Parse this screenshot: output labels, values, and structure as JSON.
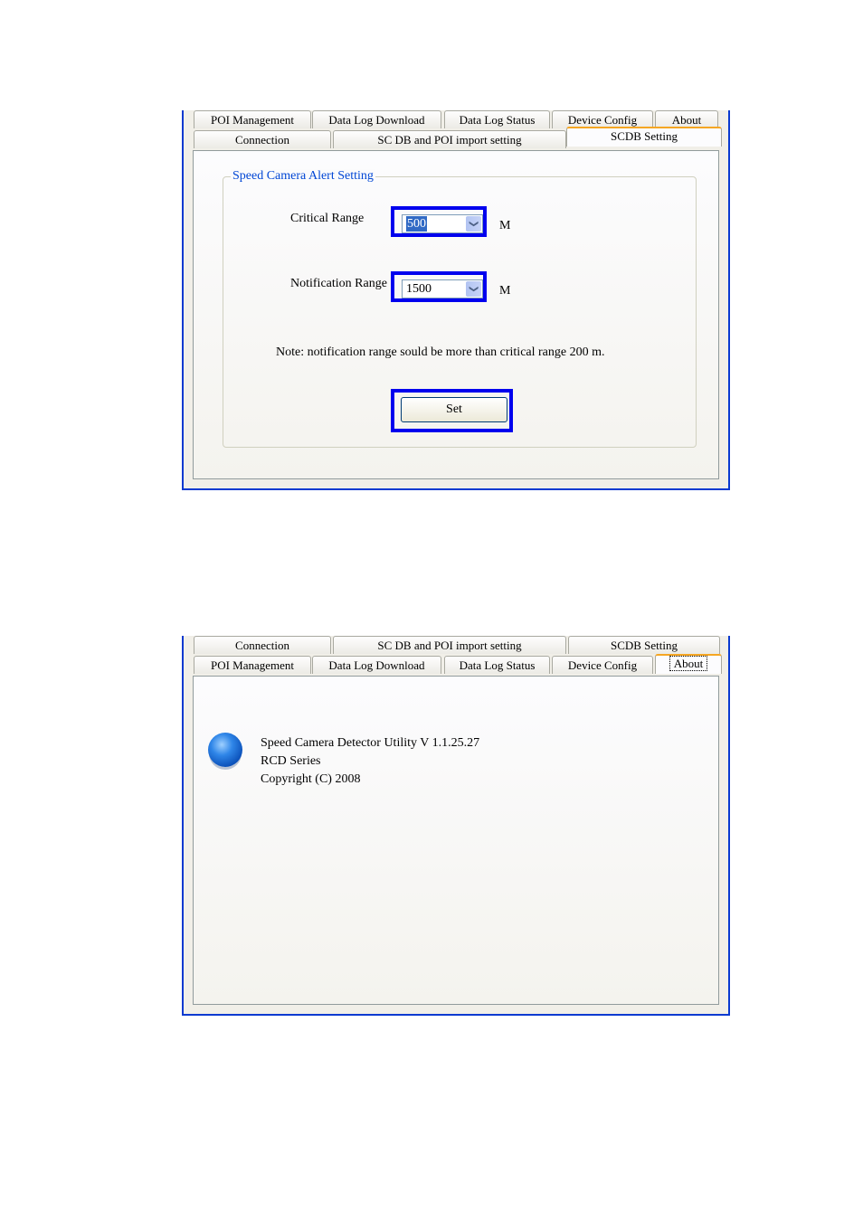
{
  "screens": [
    {
      "tabs_back_row": [
        "POI Management",
        "Data Log Download",
        "Data Log Status",
        "Device Config",
        "About"
      ],
      "tabs_front_row": [
        "Connection",
        "SC DB and POI import setting",
        "SCDB  Setting"
      ],
      "active_tab": "SCDB  Setting",
      "group_title": "Speed Camera Alert Setting",
      "critical_range": {
        "label": "Critical Range",
        "value": "500",
        "unit": "M"
      },
      "notification_range": {
        "label": "Notification Range",
        "value": "1500",
        "unit": "M"
      },
      "note": "Note: notification range sould be more than  critical range 200 m.",
      "set_button": "Set"
    },
    {
      "tabs_back_row": [
        "Connection",
        "SC DB and POI import setting",
        "SCDB  Setting"
      ],
      "tabs_front_row": [
        "POI Management",
        "Data Log Download",
        "Data Log Status",
        "Device Config",
        "About"
      ],
      "active_tab": "About",
      "about_lines": [
        "Speed Camera Detector Utility  V 1.1.25.27",
        "RCD Series",
        "Copyright (C) 2008"
      ]
    }
  ]
}
